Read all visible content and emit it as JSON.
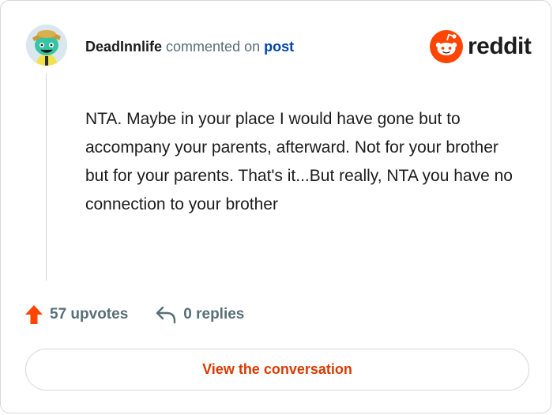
{
  "comment": {
    "username": "DeadInnlife",
    "action_text": "commented on",
    "target_link": "post",
    "body": "NTA. Maybe in your place I would have gone but to accompany your parents, afterward. Not for your brother but for your parents. That's it...But really, NTA you have no connection to your brother"
  },
  "brand": {
    "name": "reddit",
    "logo_icon": "reddit-snoo-icon",
    "accent_color": "#ff4500"
  },
  "stats": {
    "upvotes_label": "57 upvotes",
    "upvote_icon": "upvote-arrow-icon",
    "replies_label": "0 replies",
    "reply_icon": "reply-arrow-icon"
  },
  "cta": {
    "label": "View the conversation",
    "color": "#d93a00"
  }
}
